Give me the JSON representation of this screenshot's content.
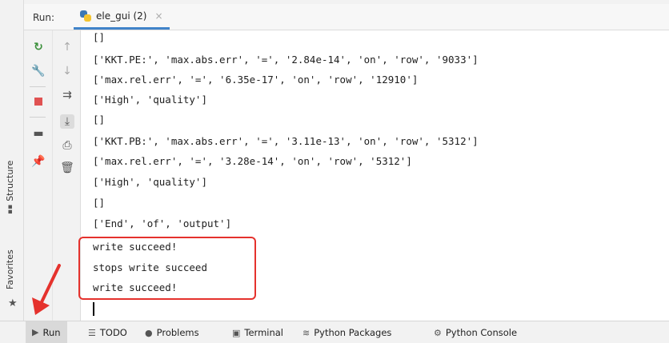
{
  "run_panel": {
    "label": "Run:",
    "tab_name": "ele_gui (2)",
    "tab_close": "×"
  },
  "console": {
    "lines": [
      "[]",
      "['KKT.PE:', 'max.abs.err', '=', '2.84e-14', 'on', 'row', '9033']",
      "['max.rel.err', '=', '6.35e-17', 'on', 'row', '12910']",
      "['High', 'quality']",
      "[]",
      "['KKT.PB:', 'max.abs.err', '=', '3.11e-13', 'on', 'row', '5312']",
      "['max.rel.err', '=', '3.28e-14', 'on', 'row', '5312']",
      "['High', 'quality']",
      "[]",
      "['End', 'of', 'output']",
      "write succeed!",
      "stops write succeed",
      "write succeed!"
    ]
  },
  "side_tabs": {
    "structure": "Structure",
    "favorites": "Favorites"
  },
  "bottom_tabs": {
    "run": "Run",
    "todo": "TODO",
    "problems": "Problems",
    "terminal": "Terminal",
    "python_packages": "Python Packages",
    "python_console": "Python Console"
  },
  "colors": {
    "highlight": "#e5322d",
    "active_tab_underline": "#4083c9"
  },
  "icons": [
    "rerun-icon",
    "wrench-icon",
    "stop-icon",
    "layout-icon",
    "pin-icon",
    "up-arrow-icon",
    "down-arrow-icon",
    "soft-wrap-icon",
    "scroll-to-end-icon",
    "print-icon",
    "trash-icon",
    "star-icon",
    "python-icon",
    "run-icon",
    "todo-icon",
    "problems-icon",
    "terminal-icon",
    "packages-icon",
    "python-console-icon"
  ]
}
